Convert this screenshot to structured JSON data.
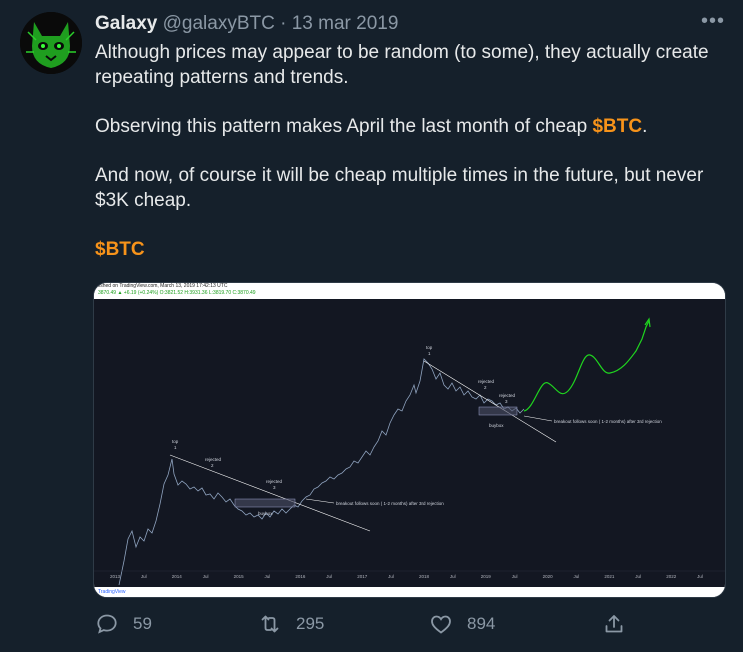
{
  "tweet": {
    "author_name": "Galaxy",
    "handle": "@galaxyBTC",
    "separator": "·",
    "date": "13 mar 2019",
    "more_icon": "more-horizontal-icon",
    "paragraphs": [
      {
        "parts": [
          {
            "text": "Although prices may appear to be random (to some), they actually create repeating patterns and trends.",
            "cash": false
          }
        ]
      },
      {
        "parts": [
          {
            "text": "Observing this pattern makes April the last month of cheap ",
            "cash": false
          },
          {
            "text": "$BTC",
            "cash": true
          },
          {
            "text": ".",
            "cash": false
          }
        ]
      },
      {
        "parts": [
          {
            "text": "And now, of course it will be cheap multiple times in the future, but never $3K cheap.",
            "cash": false
          }
        ]
      },
      {
        "parts": [
          {
            "text": "$BTC",
            "cash": true
          }
        ]
      }
    ],
    "cashtag_color": "#f7931a"
  },
  "chart": {
    "header_line1": "lished on TradingView.com, March 13, 2019 17:42:13 UTC",
    "header_line2": "3870.49 ▲ +6.19 (+0.24%) O:3821.52 H:3931.36 L:3819.70 C:3870.49",
    "footer": "TradingView",
    "annotations": {
      "top1": "top",
      "top1_num": "1",
      "rejected2": "rejected",
      "rejected2_num": "2",
      "rejected3": "rejected",
      "rejected3_num": "3",
      "buybox1": "buybox",
      "breakout1": "breakout follows soon ( 1-2 months) after 3rd rejection",
      "top2": "top",
      "top2_num": "1",
      "rejected2b": "rejected",
      "rejected2b_num": "2",
      "rejected3b": "rejected",
      "rejected3b_num": "3",
      "buybox2": "buybox",
      "breakout2": "breakout follows soon ( 1-2 months) after 3rd rejection"
    },
    "x_ticks": [
      "2013",
      "Jul",
      "2014",
      "Jul",
      "2015",
      "Jul",
      "2016",
      "Jul",
      "2017",
      "Jul",
      "2018",
      "Jul",
      "2019",
      "Jul",
      "2020",
      "Jul",
      "2021",
      "Jul",
      "2022",
      "Jul"
    ],
    "colors": {
      "price": "#8fa3bf",
      "projection": "#1fd51f",
      "background": "#131722"
    }
  },
  "actions": {
    "reply": {
      "icon": "reply-icon",
      "count": "59"
    },
    "retweet": {
      "icon": "retweet-icon",
      "count": "295"
    },
    "like": {
      "icon": "heart-icon",
      "count": "894"
    },
    "share": {
      "icon": "share-icon"
    }
  }
}
